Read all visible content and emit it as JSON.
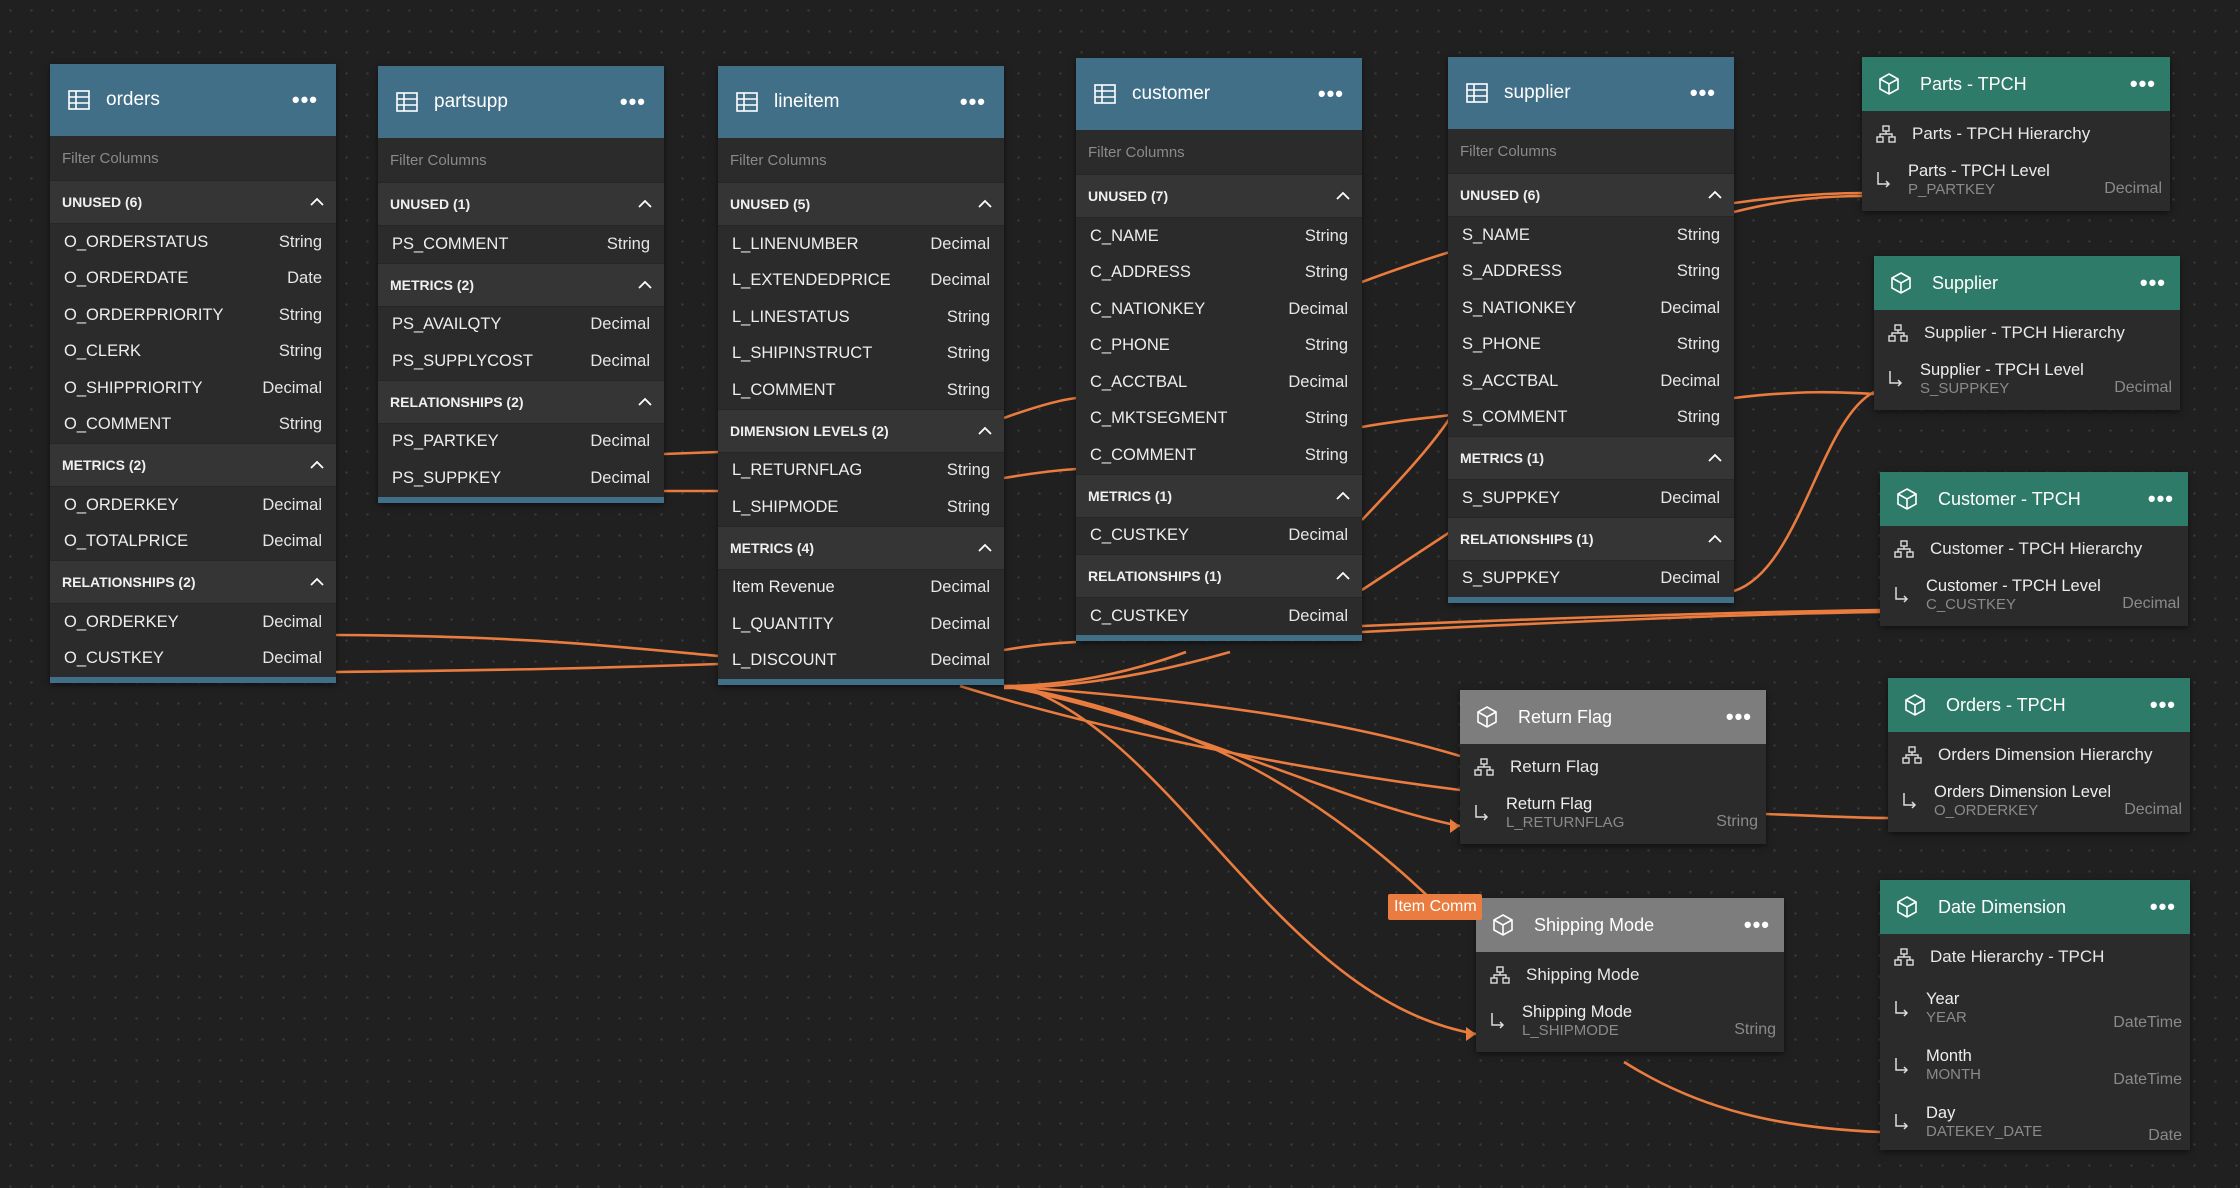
{
  "tables": {
    "orders": {
      "title": "orders",
      "filter_placeholder": "Filter Columns",
      "sections": [
        {
          "label": "UNUSED (6)",
          "rows": [
            [
              "O_ORDERSTATUS",
              "String"
            ],
            [
              "O_ORDERDATE",
              "Date"
            ],
            [
              "O_ORDERPRIORITY",
              "String"
            ],
            [
              "O_CLERK",
              "String"
            ],
            [
              "O_SHIPPRIORITY",
              "Decimal"
            ],
            [
              "O_COMMENT",
              "String"
            ]
          ]
        },
        {
          "label": "METRICS (2)",
          "rows": [
            [
              "O_ORDERKEY",
              "Decimal"
            ],
            [
              "O_TOTALPRICE",
              "Decimal"
            ]
          ]
        },
        {
          "label": "RELATIONSHIPS (2)",
          "rows": [
            [
              "O_ORDERKEY",
              "Decimal"
            ],
            [
              "O_CUSTKEY",
              "Decimal"
            ]
          ]
        }
      ]
    },
    "partsupp": {
      "title": "partsupp",
      "filter_placeholder": "Filter Columns",
      "sections": [
        {
          "label": "UNUSED (1)",
          "rows": [
            [
              "PS_COMMENT",
              "String"
            ]
          ]
        },
        {
          "label": "METRICS (2)",
          "rows": [
            [
              "PS_AVAILQTY",
              "Decimal"
            ],
            [
              "PS_SUPPLYCOST",
              "Decimal"
            ]
          ]
        },
        {
          "label": "RELATIONSHIPS (2)",
          "rows": [
            [
              "PS_PARTKEY",
              "Decimal"
            ],
            [
              "PS_SUPPKEY",
              "Decimal"
            ]
          ]
        }
      ]
    },
    "lineitem": {
      "title": "lineitem",
      "filter_placeholder": "Filter Columns",
      "sections": [
        {
          "label": "UNUSED (5)",
          "rows": [
            [
              "L_LINENUMBER",
              "Decimal"
            ],
            [
              "L_EXTENDEDPRICE",
              "Decimal"
            ],
            [
              "L_LINESTATUS",
              "String"
            ],
            [
              "L_SHIPINSTRUCT",
              "String"
            ],
            [
              "L_COMMENT",
              "String"
            ]
          ]
        },
        {
          "label": "DIMENSION LEVELS (2)",
          "rows": [
            [
              "L_RETURNFLAG",
              "String"
            ],
            [
              "L_SHIPMODE",
              "String"
            ]
          ]
        },
        {
          "label": "METRICS (4)",
          "rows": [
            [
              "Item Revenue",
              "Decimal"
            ],
            [
              "L_QUANTITY",
              "Decimal"
            ],
            [
              "L_DISCOUNT",
              "Decimal"
            ]
          ]
        }
      ]
    },
    "customer": {
      "title": "customer",
      "filter_placeholder": "Filter Columns",
      "sections": [
        {
          "label": "UNUSED (7)",
          "rows": [
            [
              "C_NAME",
              "String"
            ],
            [
              "C_ADDRESS",
              "String"
            ],
            [
              "C_NATIONKEY",
              "Decimal"
            ],
            [
              "C_PHONE",
              "String"
            ],
            [
              "C_ACCTBAL",
              "Decimal"
            ],
            [
              "C_MKTSEGMENT",
              "String"
            ],
            [
              "C_COMMENT",
              "String"
            ]
          ]
        },
        {
          "label": "METRICS (1)",
          "rows": [
            [
              "C_CUSTKEY",
              "Decimal"
            ]
          ]
        },
        {
          "label": "RELATIONSHIPS (1)",
          "rows": [
            [
              "C_CUSTKEY",
              "Decimal"
            ]
          ]
        }
      ]
    },
    "supplier": {
      "title": "supplier",
      "filter_placeholder": "Filter Columns",
      "sections": [
        {
          "label": "UNUSED (6)",
          "rows": [
            [
              "S_NAME",
              "String"
            ],
            [
              "S_ADDRESS",
              "String"
            ],
            [
              "S_NATIONKEY",
              "Decimal"
            ],
            [
              "S_PHONE",
              "String"
            ],
            [
              "S_ACCTBAL",
              "Decimal"
            ],
            [
              "S_COMMENT",
              "String"
            ]
          ]
        },
        {
          "label": "METRICS (1)",
          "rows": [
            [
              "S_SUPPKEY",
              "Decimal"
            ]
          ]
        },
        {
          "label": "RELATIONSHIPS (1)",
          "rows": [
            [
              "S_SUPPKEY",
              "Decimal"
            ]
          ]
        }
      ]
    }
  },
  "dimensions": {
    "parts": {
      "title": "Parts - TPCH",
      "hierarchy": "Parts - TPCH Hierarchy",
      "levels": [
        {
          "name": "Parts - TPCH Level",
          "column": "P_PARTKEY",
          "type": "Decimal"
        }
      ]
    },
    "supplier": {
      "title": "Supplier",
      "hierarchy": "Supplier - TPCH Hierarchy",
      "levels": [
        {
          "name": "Supplier - TPCH Level",
          "column": "S_SUPPKEY",
          "type": "Decimal"
        }
      ]
    },
    "customer": {
      "title": "Customer - TPCH",
      "hierarchy": "Customer - TPCH Hierarchy",
      "levels": [
        {
          "name": "Customer - TPCH Level",
          "column": "C_CUSTKEY",
          "type": "Decimal"
        }
      ]
    },
    "orders": {
      "title": "Orders - TPCH",
      "hierarchy": "Orders Dimension Hierarchy",
      "levels": [
        {
          "name": "Orders Dimension Level",
          "column": "O_ORDERKEY",
          "type": "Decimal"
        }
      ]
    },
    "date": {
      "title": "Date Dimension",
      "hierarchy": "Date Hierarchy - TPCH",
      "levels": [
        {
          "name": "Year",
          "column": "YEAR",
          "type": "DateTime"
        },
        {
          "name": "Month",
          "column": "MONTH",
          "type": "DateTime"
        },
        {
          "name": "Day",
          "column": "DATEKEY_DATE",
          "type": "Date"
        }
      ]
    },
    "returnflag": {
      "title": "Return Flag",
      "hierarchy": "Return Flag",
      "levels": [
        {
          "name": "Return Flag",
          "column": "L_RETURNFLAG",
          "type": "String"
        }
      ]
    },
    "shipmode": {
      "title": "Shipping Mode",
      "hierarchy": "Shipping Mode",
      "levels": [
        {
          "name": "Shipping Mode",
          "column": "L_SHIPMODE",
          "type": "String"
        }
      ]
    }
  },
  "tooltip": {
    "label": "Item Comm"
  },
  "colors": {
    "table_header": "#426f88",
    "dimension_header": "#2f7b6a",
    "dimension_header_inactive": "#7d7d7d",
    "wire": "#e97c3e",
    "background": "#202020"
  },
  "menu_icon": "ellipsis-icon"
}
